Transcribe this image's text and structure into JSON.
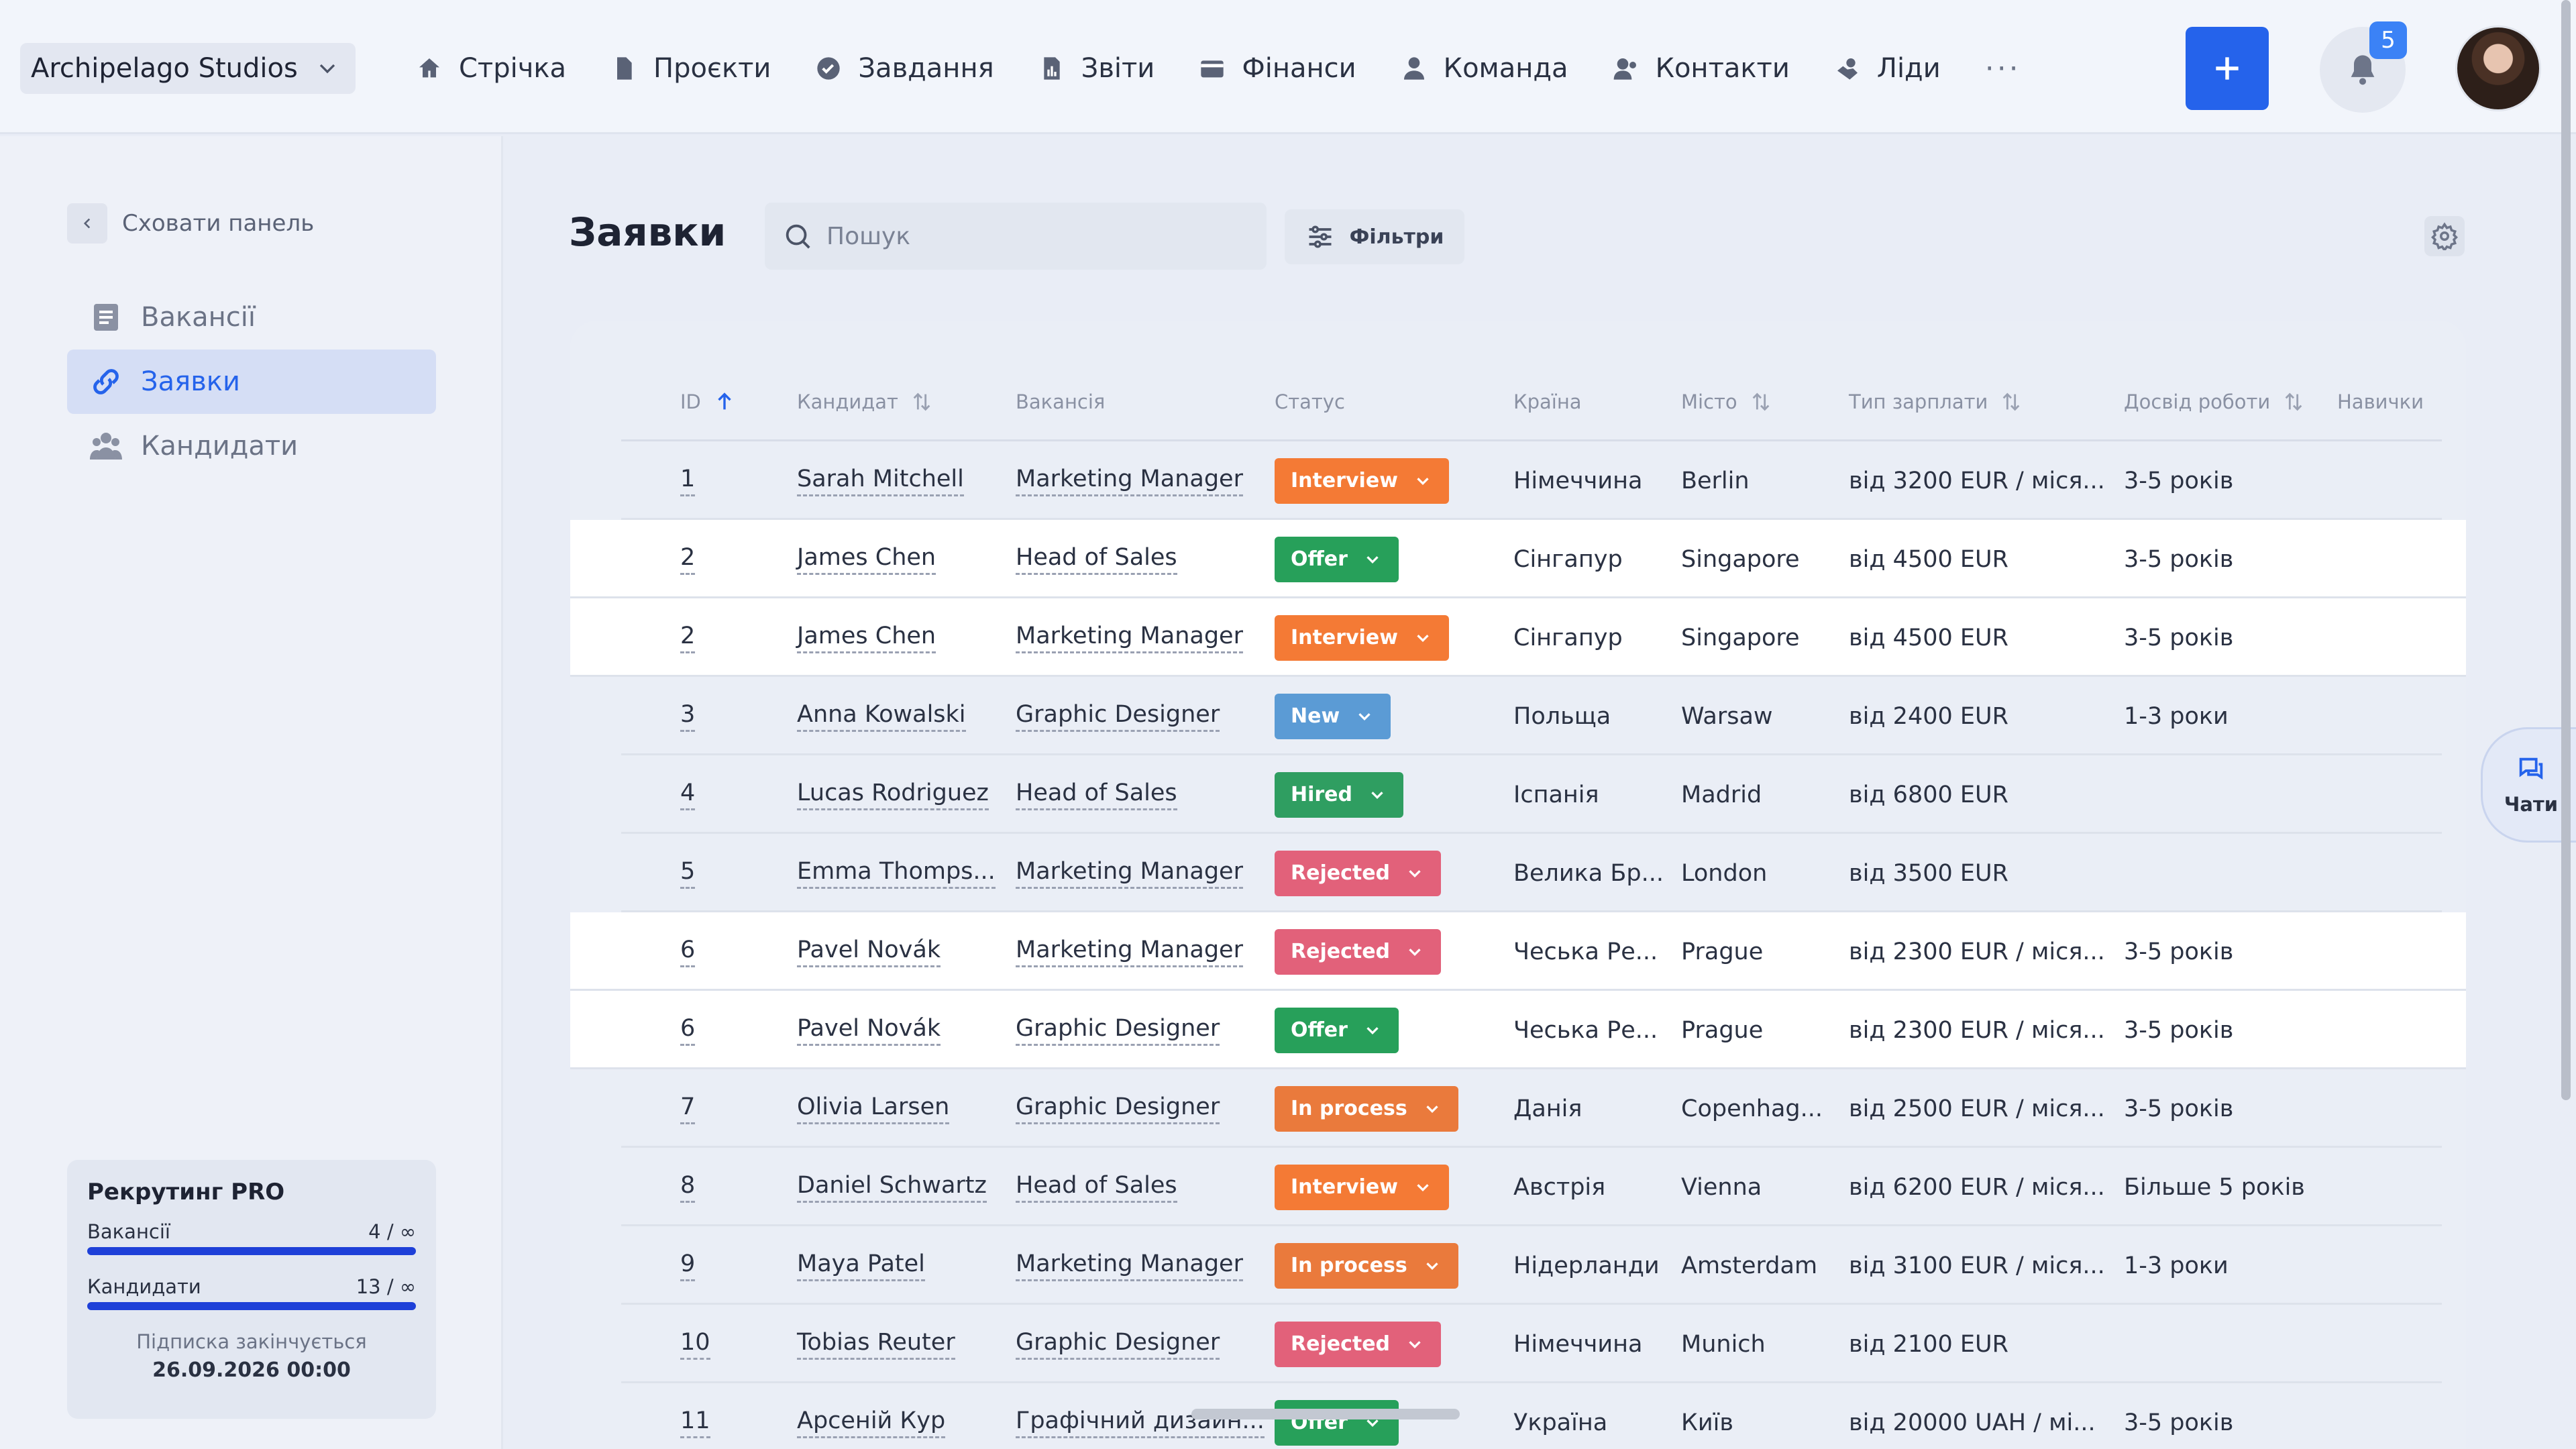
{
  "workspace": {
    "name": "Archipelago Studios"
  },
  "nav": [
    {
      "label": "Стрічка",
      "icon": "home-icon"
    },
    {
      "label": "Проєкти",
      "icon": "document-icon"
    },
    {
      "label": "Завдання",
      "icon": "check-circle-icon"
    },
    {
      "label": "Звіти",
      "icon": "chart-icon"
    },
    {
      "label": "Фінанси",
      "icon": "wallet-icon"
    },
    {
      "label": "Команда",
      "icon": "user-icon"
    },
    {
      "label": "Контакти",
      "icon": "contacts-icon"
    },
    {
      "label": "Ліди",
      "icon": "handshake-icon"
    }
  ],
  "nav_more": "···",
  "notifications": {
    "count": "5"
  },
  "sidebar": {
    "collapse_label": "Сховати панель",
    "items": [
      {
        "label": "Вакансії",
        "icon": "list-icon"
      },
      {
        "label": "Заявки",
        "icon": "link-icon"
      },
      {
        "label": "Кандидати",
        "icon": "people-icon"
      }
    ],
    "plan": {
      "title": "Рекрутинг PRO",
      "vacancies_label": "Вакансії",
      "vacancies_value": "4 / ∞",
      "vacancies_fill": 1.0,
      "candidates_label": "Кандидати",
      "candidates_value": "13 / ∞",
      "candidates_fill": 1.0,
      "note": "Підписка закінчується",
      "date": "26.09.2026 00:00"
    }
  },
  "main": {
    "title": "Заявки",
    "search_placeholder": "Пошук",
    "filters_label": "Фільтри"
  },
  "chat": {
    "label": "Чати"
  },
  "colors": {
    "accent": "#2563eb",
    "Interview": "#f47a35",
    "Offer": "#27a05a",
    "New": "#5b9bd5",
    "Hired": "#2f9e61",
    "Rejected": "#e2617a",
    "In process": "#ea7a3c"
  },
  "table": {
    "headers": {
      "id": "ID",
      "candidate": "Кандидат",
      "vacancy": "Вакансія",
      "status": "Статус",
      "country": "Країна",
      "city": "Місто",
      "salary": "Тип зарплати",
      "experience": "Досвід роботи",
      "skills": "Навички"
    },
    "rows": [
      {
        "id": "1",
        "candidate": "Sarah Mitchell",
        "vacancy": "Marketing Manager",
        "status": "Interview",
        "country": "Німеччина",
        "city": "Berlin",
        "salary": "від 3200 EUR / міся...",
        "experience": "3-5 років",
        "highlight": false
      },
      {
        "id": "2",
        "candidate": "James Chen",
        "vacancy": "Head of Sales",
        "status": "Offer",
        "country": "Сінгапур",
        "city": "Singapore",
        "salary": "від 4500 EUR",
        "experience": "3-5 років",
        "highlight": true
      },
      {
        "id": "2",
        "candidate": "James Chen",
        "vacancy": "Marketing Manager",
        "status": "Interview",
        "country": "Сінгапур",
        "city": "Singapore",
        "salary": "від 4500 EUR",
        "experience": "3-5 років",
        "highlight": true
      },
      {
        "id": "3",
        "candidate": "Anna Kowalski",
        "vacancy": "Graphic Designer",
        "status": "New",
        "country": "Польща",
        "city": "Warsaw",
        "salary": "від 2400 EUR",
        "experience": "1-3 роки",
        "highlight": false
      },
      {
        "id": "4",
        "candidate": "Lucas Rodriguez",
        "vacancy": "Head of Sales",
        "status": "Hired",
        "country": "Іспанія",
        "city": "Madrid",
        "salary": "від 6800 EUR",
        "experience": "",
        "highlight": false
      },
      {
        "id": "5",
        "candidate": "Emma Thomps...",
        "vacancy": "Marketing Manager",
        "status": "Rejected",
        "country": "Велика Бр...",
        "city": "London",
        "salary": "від 3500 EUR",
        "experience": "",
        "highlight": false
      },
      {
        "id": "6",
        "candidate": "Pavel Novák",
        "vacancy": "Marketing Manager",
        "status": "Rejected",
        "country": "Чеська Ре...",
        "city": "Prague",
        "salary": "від 2300 EUR / міся...",
        "experience": "3-5 років",
        "highlight": true
      },
      {
        "id": "6",
        "candidate": "Pavel Novák",
        "vacancy": "Graphic Designer",
        "status": "Offer",
        "country": "Чеська Ре...",
        "city": "Prague",
        "salary": "від 2300 EUR / міся...",
        "experience": "3-5 років",
        "highlight": true
      },
      {
        "id": "7",
        "candidate": "Olivia Larsen",
        "vacancy": "Graphic Designer",
        "status": "In process",
        "country": "Данія",
        "city": "Copenhag...",
        "salary": "від 2500 EUR / міся...",
        "experience": "3-5 років",
        "highlight": false
      },
      {
        "id": "8",
        "candidate": "Daniel Schwartz",
        "vacancy": "Head of Sales",
        "status": "Interview",
        "country": "Австрія",
        "city": "Vienna",
        "salary": "від 6200 EUR / міся...",
        "experience": "Більше 5 років",
        "highlight": false
      },
      {
        "id": "9",
        "candidate": "Maya Patel",
        "vacancy": "Marketing Manager",
        "status": "In process",
        "country": "Нідерланди",
        "city": "Amsterdam",
        "salary": "від 3100 EUR / міся...",
        "experience": "1-3 роки",
        "highlight": false
      },
      {
        "id": "10",
        "candidate": "Tobias Reuter",
        "vacancy": "Graphic Designer",
        "status": "Rejected",
        "country": "Німеччина",
        "city": "Munich",
        "salary": "від 2100 EUR",
        "experience": "",
        "highlight": false
      },
      {
        "id": "11",
        "candidate": "Арсеній Кур",
        "vacancy": "Графічний дизайн...",
        "status": "Offer",
        "country": "Україна",
        "city": "Київ",
        "salary": "від 20000 UAH / мі...",
        "experience": "3-5 років",
        "highlight": false
      }
    ]
  }
}
